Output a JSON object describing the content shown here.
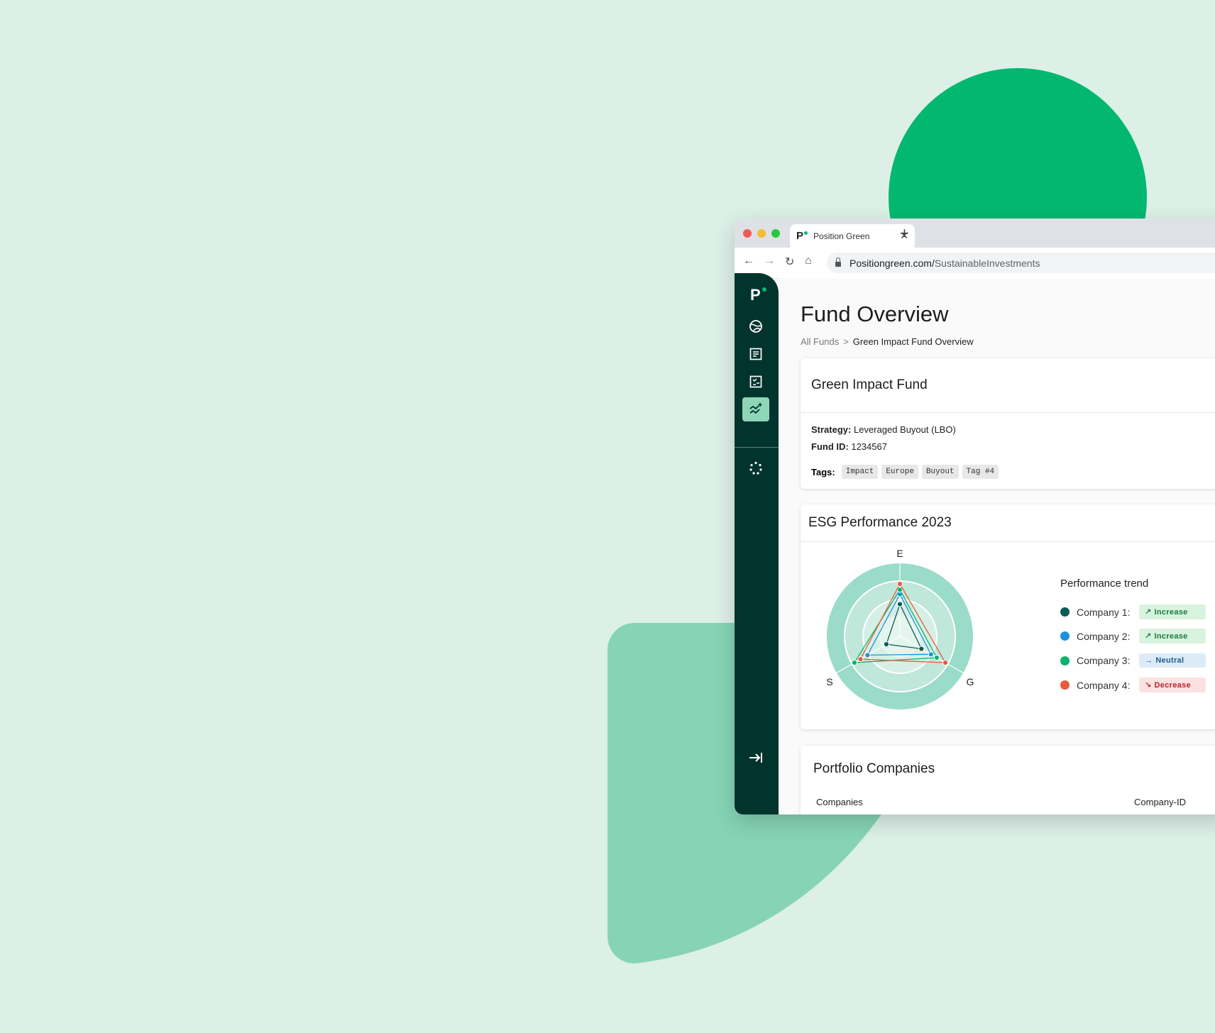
{
  "browser": {
    "tab_title": "Position Green",
    "tab_logo": "P",
    "url_host": "Positiongreen.com/",
    "url_path": " SustainableInvestments",
    "icons": [
      "back-icon",
      "forward-icon",
      "reload-icon",
      "home-icon",
      "lock-icon",
      "close-icon",
      "plus-icon"
    ]
  },
  "sidebar": {
    "logo": "P",
    "items": [
      {
        "icon": "globe-icon"
      },
      {
        "icon": "document-icon"
      },
      {
        "icon": "checklist-icon"
      },
      {
        "icon": "analytics-sparkle-icon",
        "active": true
      },
      {
        "icon": "loading-dots-icon"
      },
      {
        "icon": "collapse-arrow-icon"
      }
    ]
  },
  "page": {
    "title": "Fund Overview",
    "breadcrumb": {
      "root": "All Funds",
      "separator": ">",
      "current": "Green Impact Fund Overview"
    }
  },
  "fund": {
    "name": "Green Impact Fund",
    "strategy_label": "Strategy:",
    "strategy_value": "Leveraged Buyout (LBO)",
    "id_label": "Fund ID:",
    "id_value": "1234567",
    "tags_label": "Tags:",
    "tags": [
      "Impact",
      "Europe",
      "Buyout",
      "Tag #4"
    ]
  },
  "esg": {
    "title": "ESG Performance 2023",
    "axis_e": "E",
    "axis_s": "S",
    "axis_g": "G",
    "trend_title": "Performance trend",
    "companies": [
      {
        "name": "Company 1:",
        "color": "#0b5c55",
        "trend": "Increase",
        "trend_icon": "trending-up-icon",
        "badge_bg": "#d8f3de",
        "badge_fg": "#1b7a3d",
        "scores": {
          "E": 0.45,
          "S": 0.0,
          "G": 0.25
        }
      },
      {
        "name": "Company 2:",
        "color": "#1e90e0",
        "trend": "Increase",
        "trend_icon": "trending-up-icon",
        "badge_bg": "#d8f3de",
        "badge_fg": "#1b7a3d",
        "scores": {
          "E": 0.72,
          "S": 0.59,
          "G": 0.55
        }
      },
      {
        "name": "Company 3:",
        "color": "#0ab36d",
        "trend": "Neutral",
        "trend_icon": "arrow-right-icon",
        "badge_bg": "#dcebf7",
        "badge_fg": "#1c5f92",
        "scores": {
          "E": 0.84,
          "S": 1.0,
          "G": 0.73
        }
      },
      {
        "name": "Company 4:",
        "color": "#e85b3c",
        "trend": "Decrease",
        "trend_icon": "trending-down-icon",
        "badge_bg": "#fbe1e1",
        "badge_fg": "#b3262b",
        "scores": {
          "E": 1.0,
          "S": 0.81,
          "G": 1.0
        }
      }
    ]
  },
  "portfolio": {
    "title": "Portfolio Companies",
    "columns": [
      "Companies",
      "Company-ID"
    ]
  },
  "colors": {
    "background": "#dcf0e8",
    "brand_green": "#02b870",
    "sidebar": "#00342d",
    "radar_outer": "#9adcc9"
  }
}
